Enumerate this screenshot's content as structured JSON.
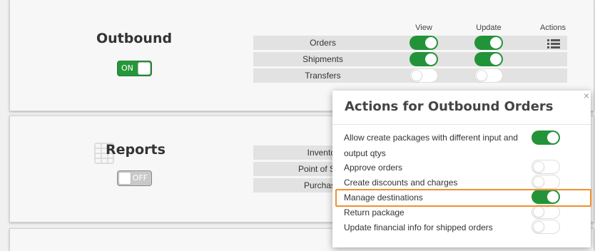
{
  "outbound": {
    "title": "Outbound",
    "switch": {
      "label": "ON",
      "state": "on"
    },
    "columns": {
      "view": "View",
      "update": "Update",
      "actions": "Actions"
    },
    "rows": [
      {
        "label": "Orders",
        "view": true,
        "update": true
      },
      {
        "label": "Shipments",
        "view": true,
        "update": true
      },
      {
        "label": "Transfers",
        "view": false,
        "update": false
      }
    ],
    "actions_icon": "list-icon"
  },
  "reports": {
    "title": "Reports",
    "switch": {
      "label": "OFF",
      "state": "off"
    },
    "rows": [
      {
        "label": "Invento"
      },
      {
        "label": "Point of S"
      },
      {
        "label": "Purchas"
      }
    ],
    "icon": "table-icon"
  },
  "modal": {
    "title": "Actions for Outbound Orders",
    "close_icon": "×",
    "actions": [
      {
        "label": "Allow create packages with different input and output qtys",
        "enabled": true
      },
      {
        "label": "Approve orders",
        "enabled": false
      },
      {
        "label": "Create discounts and charges",
        "enabled": false
      },
      {
        "label": "Manage destinations",
        "enabled": true,
        "highlighted": true
      },
      {
        "label": "Return package",
        "enabled": false
      },
      {
        "label": "Update financial info for shipped orders",
        "enabled": false
      }
    ]
  },
  "colors": {
    "toggle_on": "#23933a",
    "highlight": "#f0902e"
  }
}
